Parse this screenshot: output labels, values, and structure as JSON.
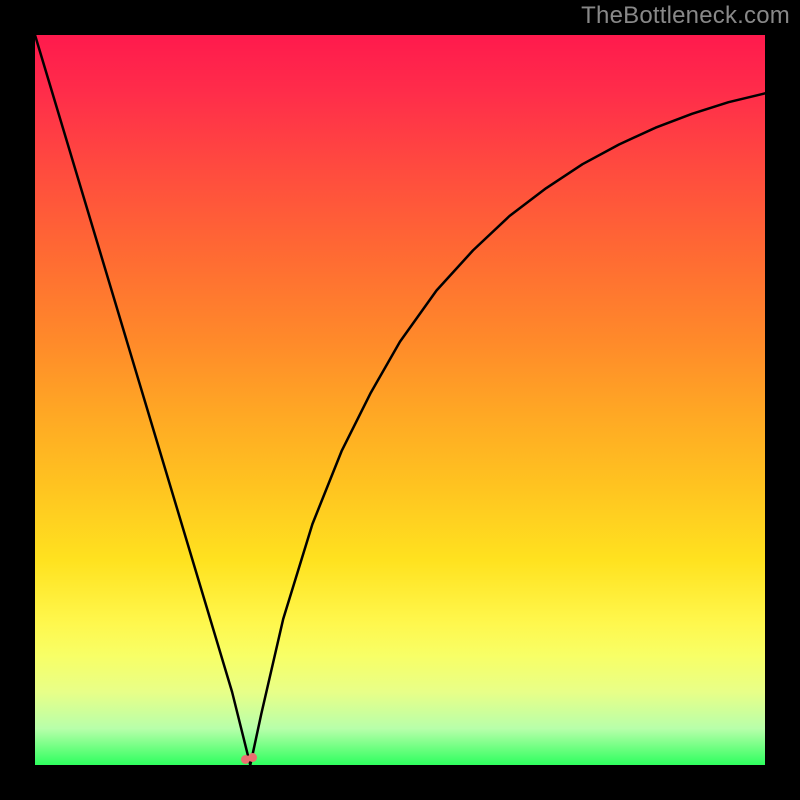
{
  "watermark": "TheBottleneck.com",
  "colors": {
    "frame": "#000000",
    "gradient_top": "#ff1a4d",
    "gradient_bottom": "#2eff5e",
    "curve_stroke": "#000000",
    "marker": "#e97070",
    "watermark_text": "#888888"
  },
  "chart_data": {
    "type": "line",
    "title": "",
    "xlabel": "",
    "ylabel": "",
    "xlim": [
      0,
      100
    ],
    "ylim": [
      0,
      100
    ],
    "grid": false,
    "legend": false,
    "series": [
      {
        "name": "curve",
        "x": [
          0,
          3,
          6,
          9,
          12,
          15,
          18,
          21,
          24,
          27,
          29.5,
          31,
          34,
          38,
          42,
          46,
          50,
          55,
          60,
          65,
          70,
          75,
          80,
          85,
          90,
          95,
          100
        ],
        "y": [
          100,
          90,
          80,
          70,
          60,
          50,
          40,
          30,
          20,
          10,
          0,
          7,
          20,
          33,
          43,
          51,
          58,
          65,
          70.5,
          75.2,
          79,
          82.3,
          85,
          87.3,
          89.2,
          90.8,
          92
        ]
      }
    ],
    "annotations": [
      {
        "name": "min-marker",
        "x": 29.5,
        "y": 0
      }
    ],
    "notes": "Values are estimated from gradient scale: y=100 at top (red), y=0 at bottom (green). The curve is the black V-shaped line reaching its minimum near x≈29.5."
  }
}
